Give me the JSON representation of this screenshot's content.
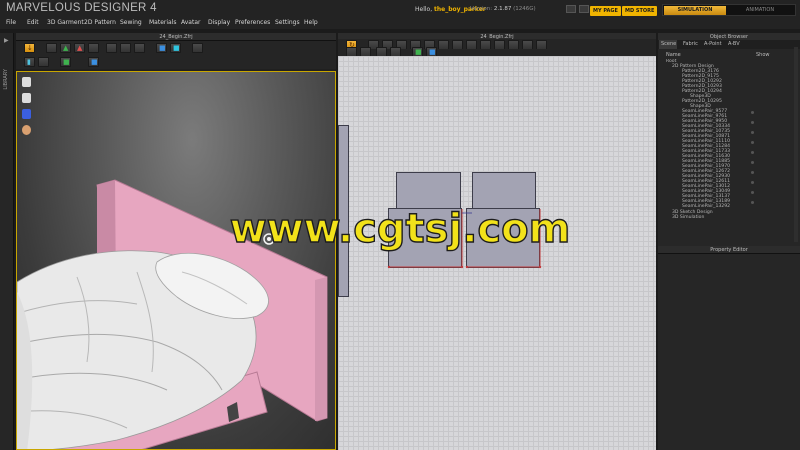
{
  "app": {
    "title": "MARVELOUS DESIGNER 4",
    "greeting": "Hello,",
    "username": "the_boy_parker",
    "version_label": "Version:",
    "version_value": "2.1.87",
    "build": "(1246G)",
    "my_page": "MY PAGE",
    "md_store": "MD STORE",
    "mode_simulation": "SIMULATION",
    "mode_animation": "ANIMATION"
  },
  "menu": [
    "File",
    "Edit",
    "3D Garment",
    "2D Pattern",
    "Sewing",
    "Materials",
    "Avatar",
    "Display",
    "Preferences",
    "Settings",
    "Help"
  ],
  "library": {
    "label": "LIBRARY"
  },
  "panel3d": {
    "tab_title": "24_Begin.Zfrj"
  },
  "panel2d": {
    "tab_title": "24_Begin.Zfrj"
  },
  "object_browser": {
    "title": "Object Browser",
    "tabs": [
      "Scene",
      "Fabric",
      "A-Point",
      "A-BV"
    ],
    "col_name": "Name",
    "col_show": "Show",
    "tree": [
      "Root",
      "2D Pattern Design",
      "Pattern2D_3176",
      "Pattern2D_9175",
      "Pattern2D_10292",
      "Pattern2D_10293",
      "Pattern2D_10294",
      "Shape3D",
      "Pattern2D_10295",
      "Shape3D",
      "SeamLinePair_9577",
      "SeamLinePair_9761",
      "SeamLinePair_9950",
      "SeamLinePair_10334",
      "SeamLinePair_10735",
      "SeamLinePair_10871",
      "SeamLinePair_11110",
      "SeamLinePair_11284",
      "SeamLinePair_11733",
      "SeamLinePair_11630",
      "SeamLinePair_11885",
      "SeamLinePair_11970",
      "SeamLinePair_12672",
      "SeamLinePair_12930",
      "SeamLinePair_12611",
      "SeamLinePair_13012",
      "SeamLinePair_13049",
      "SeamLinePair_13137",
      "SeamLinePair_13189",
      "SeamLinePair_13292",
      "3D Sketch Design",
      "3D Simulation"
    ]
  },
  "property_editor": {
    "title": "Property Editor"
  },
  "watermark": "www.cgtsj.com",
  "colors": {
    "accent": "#f0b400",
    "headboard": "#e7a6c0",
    "pattern": "#a3a3b3",
    "grid": "#d7d7da"
  }
}
